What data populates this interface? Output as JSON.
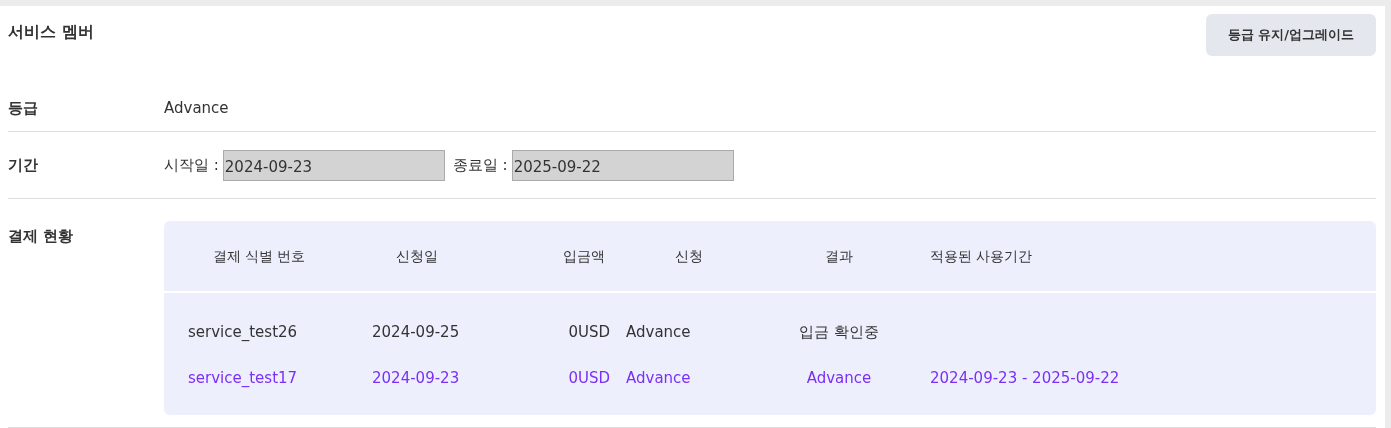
{
  "section_title": "서비스 멤버",
  "upgrade_button": "등급 유지/업그레이드",
  "grade": {
    "label": "등급",
    "value": "Advance"
  },
  "period": {
    "label": "기간",
    "start_label": "시작일 :",
    "start_value": "2024-09-23",
    "end_label": "종료일 :",
    "end_value": "2025-09-22"
  },
  "payments": {
    "label": "결제 현황",
    "columns": [
      "결제 식별 번호",
      "신청일",
      "입금액",
      "신청",
      "결과",
      "적용된 사용기간"
    ],
    "rows": [
      {
        "selected": false,
        "cells": [
          "service_test26",
          "2024-09-25",
          "0USD",
          "Advance",
          "입금 확인중",
          ""
        ]
      },
      {
        "selected": true,
        "cells": [
          "service_test17",
          "2024-09-23",
          "0USD",
          "Advance",
          "Advance",
          "2024-09-23 - 2025-09-22"
        ]
      }
    ]
  }
}
